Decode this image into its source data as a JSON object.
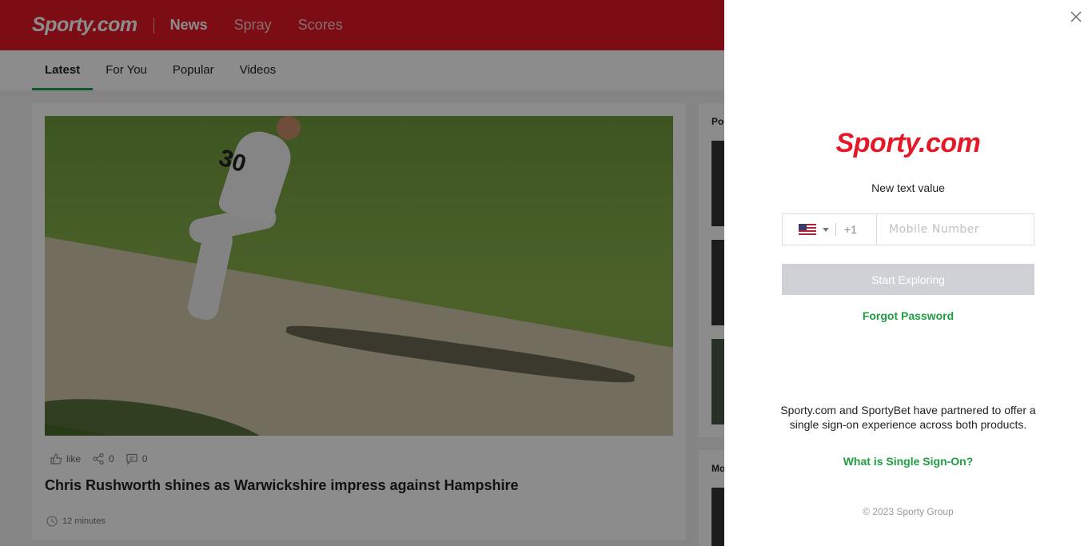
{
  "header": {
    "logo": "Sporty.com",
    "nav": [
      "News",
      "Spray",
      "Scores"
    ]
  },
  "subnav": {
    "tabs": [
      "Latest",
      "For You",
      "Popular",
      "Videos"
    ]
  },
  "article": {
    "like_label": "like",
    "share_count": "0",
    "comment_count": "0",
    "headline": "Chris Rushworth shines as Warwickshire impress against Hampshire",
    "time": "12 minutes",
    "hero_number": "30"
  },
  "sidebar": {
    "section1_label": "Po",
    "section2_label": "Mo"
  },
  "modal": {
    "logo": "Sporty.com",
    "subtitle": "New text value",
    "country_code": "+1",
    "phone_placeholder": "Mobile Number",
    "start_button": "Start Exploring",
    "forgot_password": "Forgot Password",
    "sso_text": "Sporty.com and SportyBet have partnered to offer a single sign-on experience across both products.",
    "sso_link": "What is Single Sign-On?",
    "copyright": "© 2023 Sporty Group"
  },
  "colors": {
    "brand_red": "#e41827",
    "accent_green": "#1f9d41",
    "disabled_button": "#cfd1d6"
  },
  "icons": [
    "close-icon",
    "us-flag-icon",
    "thumbs-up-icon",
    "share-icon",
    "comment-icon",
    "clock-icon"
  ]
}
